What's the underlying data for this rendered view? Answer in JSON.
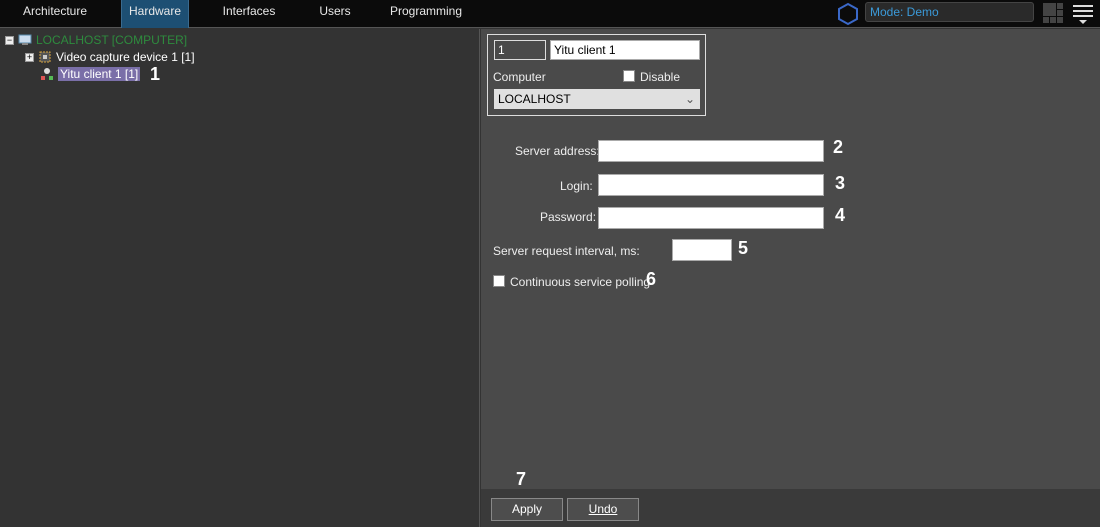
{
  "tabs": [
    {
      "label": "Architecture"
    },
    {
      "label": "Hardware",
      "active": true
    },
    {
      "label": "Interfaces"
    },
    {
      "label": "Users"
    },
    {
      "label": "Programming"
    }
  ],
  "mode": "Mode: Demo",
  "tree": {
    "root": "LOCALHOST [COMPUTER]",
    "child1": "Video capture device 1 [1]",
    "child2": "Yitu client 1 [1]"
  },
  "card": {
    "id": "1",
    "name": "Yitu client 1",
    "computer_label": "Computer",
    "disable_label": "Disable",
    "computer_value": "LOCALHOST"
  },
  "form": {
    "server_address_label": "Server address:",
    "login_label": "Login:",
    "password_label": "Password:",
    "interval_label": "Server request interval, ms:",
    "polling_label": "Continuous service polling",
    "server_address": "",
    "login": "",
    "password": "",
    "interval": ""
  },
  "callouts": [
    "1",
    "2",
    "3",
    "4",
    "5",
    "6",
    "7"
  ],
  "buttons": {
    "apply": "Apply",
    "undo": "Undo"
  },
  "colors": {
    "accent": "#1d4f73",
    "root_text": "#2e8b3e",
    "mode_text": "#3b9ad9",
    "selection": "#7a6fa8"
  }
}
